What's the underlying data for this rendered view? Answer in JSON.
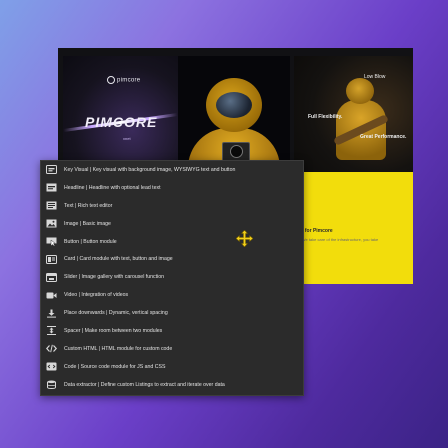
{
  "preview": {
    "tile1": {
      "brand": "pimcore",
      "word": "PIMCORE",
      "subtitle": "xnet"
    },
    "tile3": {
      "line1": "Low Blow",
      "line2": "Full Flexibility.",
      "line3": "Great Performance."
    },
    "yellow": {
      "title": "ing for Pimcore",
      "subtitle": "re. We take care of the infrastructure, you take"
    }
  },
  "menu": {
    "items": [
      {
        "label": "Key Visual | Key visual with background image, WYSIWYG text and button",
        "icon": "key-visual-icon"
      },
      {
        "label": "Headline | Headline with optional lead text",
        "icon": "headline-icon"
      },
      {
        "label": "Text | Rich text editor",
        "icon": "text-icon"
      },
      {
        "label": "Image | Basic image",
        "icon": "image-icon"
      },
      {
        "label": "Button | Button module",
        "icon": "button-icon"
      },
      {
        "label": "Card | Card module with text, button and image",
        "icon": "card-icon"
      },
      {
        "label": "Slider | Image gallery with carousel function",
        "icon": "slider-icon"
      },
      {
        "label": "Video | Integration of videos",
        "icon": "video-icon"
      },
      {
        "label": "Place downwards | Dynamic, vertical spacing",
        "icon": "place-downwards-icon"
      },
      {
        "label": "Spacer | Make room between two modules",
        "icon": "spacer-icon"
      },
      {
        "label": "Custom HTML | HTML module for custom code",
        "icon": "custom-html-icon"
      },
      {
        "label": "Code | Source code module for JS and CSS",
        "icon": "code-icon"
      },
      {
        "label": "Data extractor | Define custom Listings to extract and iterate over data",
        "icon": "data-extractor-icon"
      }
    ]
  },
  "colors": {
    "menu_bg": "#2b2b2b",
    "text": "#e4e4e4",
    "accent_yellow": "#f2dd0c",
    "cursor": "#f2cf1c"
  }
}
